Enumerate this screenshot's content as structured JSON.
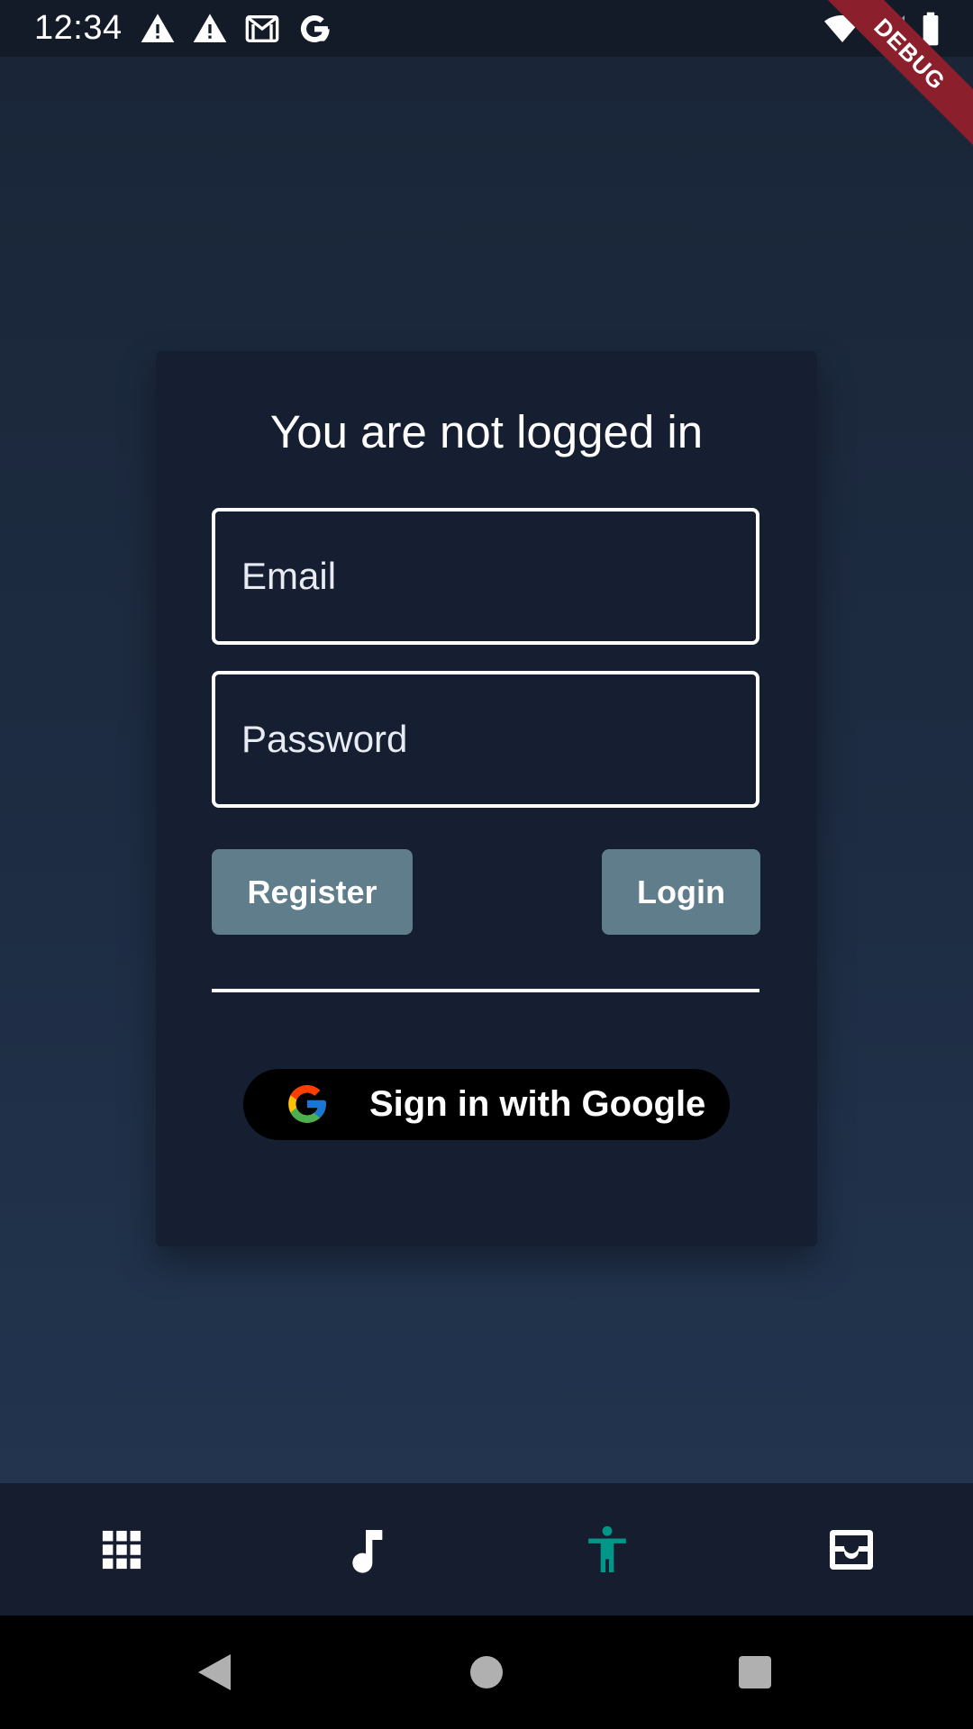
{
  "status_bar": {
    "time": "12:34",
    "left_icons": [
      "warning-icon",
      "warning-icon",
      "gmail-icon",
      "google-g-icon"
    ],
    "right_icons": [
      "wifi-icon",
      "cell-signal-icon",
      "battery-icon"
    ]
  },
  "debug_banner": "DEBUG",
  "card": {
    "title": "You are not logged in",
    "email_placeholder": "Email",
    "password_placeholder": "Password",
    "register_label": "Register",
    "login_label": "Login",
    "google_label": "Sign in with Google"
  },
  "bottom_nav": {
    "items": [
      {
        "icon": "apps-grid-icon",
        "active": false
      },
      {
        "icon": "music-note-icon",
        "active": false
      },
      {
        "icon": "accessibility-icon",
        "active": true
      },
      {
        "icon": "inbox-icon",
        "active": false
      }
    ],
    "active_color": "#009688"
  },
  "colors": {
    "card_bg": "#161e31",
    "button_bg": "#607d8b",
    "background": "#1e2d44"
  }
}
